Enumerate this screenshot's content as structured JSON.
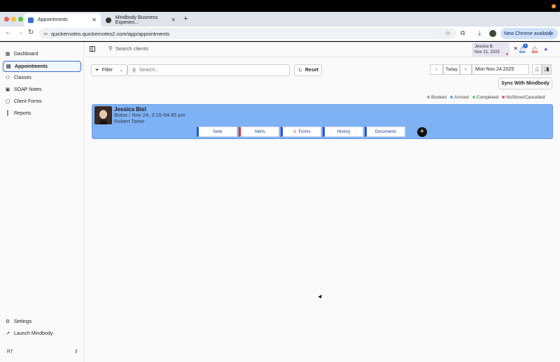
{
  "browser": {
    "tabs": [
      {
        "title": "Appointments",
        "favicon_color": "#3b6ecf"
      },
      {
        "title": "Mindbody Business Experien...",
        "favicon_color": "#333333"
      }
    ],
    "url": "quickernotes.quickernotes2.com/app/appointments",
    "new_chrome_label": "New Chrome available",
    "icons": [
      "back-icon",
      "forward-icon",
      "reload-icon",
      "star-icon",
      "download-icon",
      "menu-dots-icon"
    ]
  },
  "sidebar": {
    "items": [
      {
        "label": "Dashboard",
        "icon": "▦"
      },
      {
        "label": "Appointments",
        "icon": "▤",
        "active": true
      },
      {
        "label": "Classes",
        "icon": "⚇"
      },
      {
        "label": "SOAP Notes",
        "icon": "▣"
      },
      {
        "label": "Client Forms",
        "icon": "▢"
      },
      {
        "label": "Reports",
        "icon": "┃"
      }
    ],
    "bottom_items": [
      {
        "label": "Settings",
        "icon": "⚙"
      },
      {
        "label": "Launch Mindbody",
        "icon": "↗"
      }
    ],
    "user_initials": "RT"
  },
  "header": {
    "search_placeholder": "Search clients",
    "user_chip": {
      "name": "Jessica B.",
      "date": "Nov 21, 2025"
    },
    "notification_count": "1"
  },
  "toolbar": {
    "filter_label": "Filter",
    "search_placeholder": "Search...",
    "reset_label": "Reset",
    "today_label": "Today",
    "date_value": "Mon Nov 24 2025",
    "sync_label": "Sync With Mindbody"
  },
  "legend": [
    {
      "label": "Booked",
      "color": "#9aa6b5"
    },
    {
      "label": "Arrived",
      "color": "#6ea3e6"
    },
    {
      "label": "Completed",
      "color": "#6ccf7c"
    },
    {
      "label": "NoShow/Cancelled",
      "color": "#e86060"
    }
  ],
  "appointment": {
    "client_name": "Jessica Biel",
    "service": "Botox / Nov 24, 3:15-04:45 pm",
    "staff": "Robert Tarter",
    "actions": [
      "Note",
      "Alerts",
      "Forms",
      "History",
      "Documents"
    ],
    "card_color": "#7fb2f4"
  }
}
